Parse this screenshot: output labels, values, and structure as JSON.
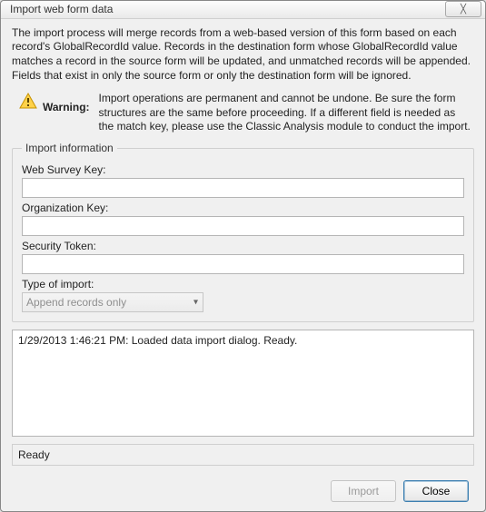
{
  "window": {
    "title": "Import web form data",
    "close_glyph": "╳"
  },
  "intro": "The import process will merge records from a web-based version of this form based on each record's GlobalRecordId value. Records in the destination form whose GlobalRecordId value matches a record in the source form will be updated, and unmatched records will be appended. Fields that exist in only the source form or only the destination form will be ignored.",
  "warning": {
    "label": "Warning:",
    "text": "Import operations are permanent and cannot be undone. Be sure the form structures are the same before proceeding. If a different field is needed as the match key, please use the Classic Analysis module to conduct the import."
  },
  "group": {
    "legend": "Import information",
    "web_survey_key": {
      "label": "Web Survey Key:",
      "value": ""
    },
    "organization_key": {
      "label": "Organization Key:",
      "value": ""
    },
    "security_token": {
      "label": "Security Token:",
      "value": ""
    },
    "type_of_import": {
      "label": "Type of import:",
      "selected": "Append records only"
    }
  },
  "log": {
    "line1": "1/29/2013 1:46:21 PM: Loaded data import dialog. Ready."
  },
  "status": "Ready",
  "buttons": {
    "import": "Import",
    "close": "Close"
  }
}
